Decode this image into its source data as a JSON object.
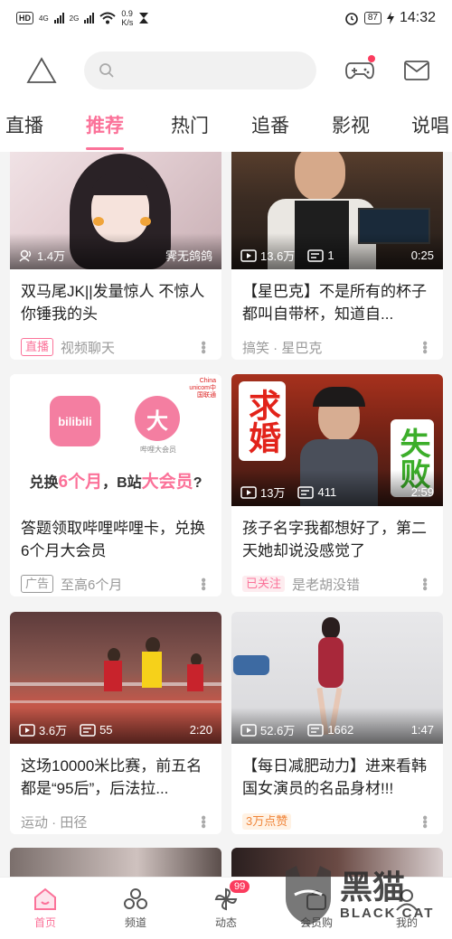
{
  "status_bar": {
    "hd_label": "HD",
    "net1": "4G",
    "net2": "2G",
    "speed_value": "0.9",
    "speed_unit": "K/s",
    "battery": "87",
    "time": "14:32"
  },
  "header": {
    "search_placeholder": ""
  },
  "tabs": [
    {
      "label": "直播"
    },
    {
      "label": "推荐"
    },
    {
      "label": "热门"
    },
    {
      "label": "追番"
    },
    {
      "label": "影视"
    },
    {
      "label": "说唱"
    }
  ],
  "cards": [
    {
      "views": "1.4万",
      "extra": "霁无鸽鸽",
      "title": "双马尾JK||发量惊人 不惊人你锤我的头",
      "badge": "直播",
      "meta": "视频聊天"
    },
    {
      "views": "13.6万",
      "comments": "1",
      "duration": "0:25",
      "title": "【星巴克】不是所有的杯子都叫自带杯，知道自...",
      "meta": "搞笑 · 星巴克"
    },
    {
      "ad_line_a": "兑换",
      "ad_line_b": "6个月",
      "ad_line_c": "，B站",
      "ad_line_d": "大会员",
      "ad_line_e": "?",
      "ad_logo": "bilibili",
      "ad_circle": "大",
      "ad_circle_sub": "哔哩大会员",
      "ad_corner": "China unicom中国联通",
      "title": "答题领取哔哩哔哩卡，兑换6个月大会员",
      "badge": "广告",
      "meta": "至高6个月"
    },
    {
      "thumb_left": "求婚",
      "thumb_right": "失败",
      "views": "13万",
      "comments": "411",
      "duration": "2:59",
      "title": "孩子名字我都想好了，第二天她却说没感觉了",
      "badge": "已关注",
      "meta": "是老胡没错"
    },
    {
      "views": "3.6万",
      "comments": "55",
      "duration": "2:20",
      "title": "这场10000米比赛，前五名都是“95后”，后法拉...",
      "meta": "运动 · 田径"
    },
    {
      "views": "52.6万",
      "comments": "1662",
      "duration": "1:47",
      "title": "【每日减肥动力】进来看韩国女演员的名品身材!!!",
      "badge": "3万点赞"
    }
  ],
  "bottom_nav": [
    {
      "label": "首页"
    },
    {
      "label": "频道"
    },
    {
      "label": "动态",
      "badge": "99"
    },
    {
      "label": "会员购"
    },
    {
      "label": "我的"
    }
  ],
  "watermark": {
    "cn": "黑猫",
    "en": "BLACK CAT"
  },
  "colors": {
    "accent": "#fb7299",
    "badge_red": "#fb3c5e"
  }
}
